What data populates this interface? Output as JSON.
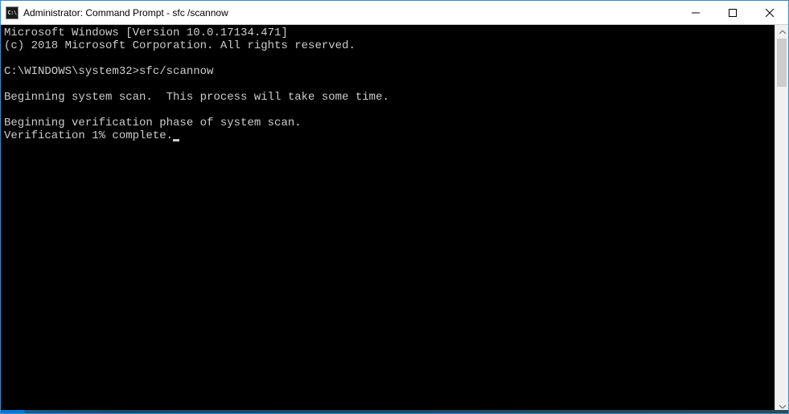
{
  "window": {
    "icon_label": "C:\\",
    "title": "Administrator: Command Prompt - sfc  /scannow"
  },
  "terminal": {
    "line1": "Microsoft Windows [Version 10.0.17134.471]",
    "line2": "(c) 2018 Microsoft Corporation. All rights reserved.",
    "prompt": "C:\\WINDOWS\\system32>",
    "command": "sfc/scannow",
    "msg1": "Beginning system scan.  This process will take some time.",
    "msg2": "Beginning verification phase of system scan.",
    "msg3": "Verification 1% complete."
  }
}
